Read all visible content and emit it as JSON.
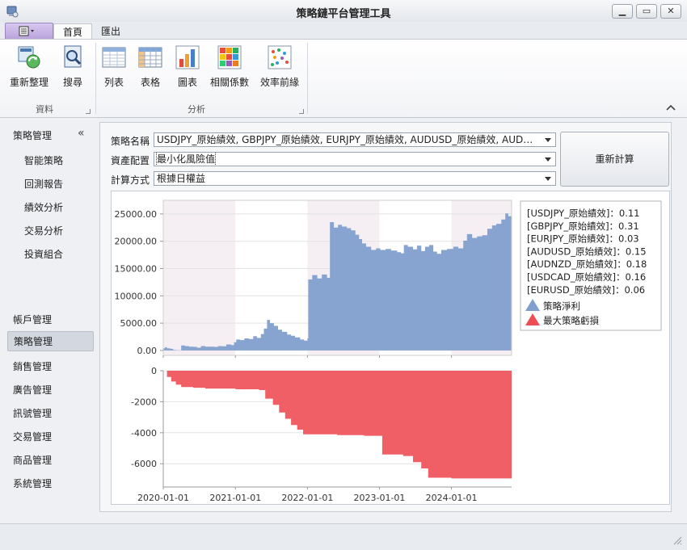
{
  "window": {
    "title": "策略鏈平台管理工具"
  },
  "tabs": [
    {
      "label": "首頁",
      "active": true
    },
    {
      "label": "匯出",
      "active": false
    }
  ],
  "ribbon": {
    "groups": [
      {
        "label": "資料",
        "buttons": [
          {
            "label": "重新整理",
            "icon": "refresh-icon"
          },
          {
            "label": "搜尋",
            "icon": "search-icon"
          }
        ]
      },
      {
        "label": "分析",
        "buttons": [
          {
            "label": "列表",
            "icon": "list-icon"
          },
          {
            "label": "表格",
            "icon": "table-icon"
          },
          {
            "label": "圖表",
            "icon": "bar-chart-icon"
          },
          {
            "label": "相關係數",
            "icon": "correlation-icon"
          },
          {
            "label": "效率前緣",
            "icon": "scatter-icon"
          }
        ]
      }
    ]
  },
  "sidebar": {
    "header": "策略管理",
    "sub_items": [
      "智能策略",
      "回測報告",
      "績效分析",
      "交易分析",
      "投資組合"
    ],
    "items": [
      "帳戶管理",
      "策略管理",
      "銷售管理",
      "廣告管理",
      "訊號管理",
      "交易管理",
      "商品管理",
      "系統管理"
    ],
    "selected": "策略管理"
  },
  "form": {
    "strategy_label": "策略名稱",
    "strategy_value": "USDJPY_原始績效, GBPJPY_原始績效, EURJPY_原始績效, AUDUSD_原始績效, AUDNZD_原始績效",
    "allocation_label": "資產配置",
    "allocation_value": "最小化風險值",
    "method_label": "計算方式",
    "method_value": "根據日權益",
    "recalc_button": "重新計算"
  },
  "legend": {
    "weights": [
      "[USDJPY_原始績效]：0.11",
      "[GBPJPY_原始績效]：0.31",
      "[EURJPY_原始績效]：0.03",
      "[AUDUSD_原始績效]：0.15",
      "[AUDNZD_原始績效]：0.18",
      "[USDCAD_原始績效]：0.16",
      "[EURUSD_原始績效]：0.06"
    ],
    "series": [
      {
        "name": "策略淨利",
        "color": "#7f9fcc"
      },
      {
        "name": "最大策略虧損",
        "color": "#ee4d55"
      }
    ]
  },
  "chart_data": {
    "type": "area",
    "x_ticks": [
      "2020-01-01",
      "2021-01-01",
      "2022-01-01",
      "2023-01-01",
      "2024-01-01"
    ],
    "x_range": [
      "2020-01-01",
      "2024-11-01"
    ],
    "panels": [
      {
        "series": "策略淨利",
        "ylim": [
          -900,
          27500
        ],
        "y_ticks": [
          0,
          5000,
          10000,
          15000,
          20000,
          25000
        ],
        "y_tick_labels": [
          "0.00",
          "5000.00",
          "10000.00",
          "15000.00",
          "20000.00",
          "25000.00"
        ],
        "color": "#7f9fcc",
        "points": [
          [
            "2020-01-01",
            400
          ],
          [
            "2020-01-10",
            600
          ],
          [
            "2020-01-20",
            400
          ],
          [
            "2020-02-05",
            300
          ],
          [
            "2020-02-20",
            100
          ],
          [
            "2020-03-05",
            50
          ],
          [
            "2020-04-01",
            900
          ],
          [
            "2020-04-20",
            800
          ],
          [
            "2020-05-10",
            700
          ],
          [
            "2020-06-01",
            650
          ],
          [
            "2020-06-20",
            500
          ],
          [
            "2020-07-10",
            800
          ],
          [
            "2020-08-01",
            700
          ],
          [
            "2020-08-20",
            700
          ],
          [
            "2020-09-15",
            650
          ],
          [
            "2020-10-05",
            800
          ],
          [
            "2020-10-25",
            750
          ],
          [
            "2020-11-15",
            1100
          ],
          [
            "2020-12-10",
            1000
          ],
          [
            "2020-12-25",
            1500
          ],
          [
            "2021-01-05",
            2000
          ],
          [
            "2021-01-25",
            1900
          ],
          [
            "2021-02-15",
            2200
          ],
          [
            "2021-03-10",
            2100
          ],
          [
            "2021-04-01",
            2600
          ],
          [
            "2021-04-20",
            2300
          ],
          [
            "2021-05-10",
            3000
          ],
          [
            "2021-05-25",
            4000
          ],
          [
            "2021-06-10",
            5600
          ],
          [
            "2021-06-25",
            5000
          ],
          [
            "2021-07-15",
            4500
          ],
          [
            "2021-08-05",
            3800
          ],
          [
            "2021-08-25",
            3400
          ],
          [
            "2021-09-20",
            2900
          ],
          [
            "2021-10-10",
            2700
          ],
          [
            "2021-10-30",
            2400
          ],
          [
            "2021-11-25",
            2000
          ],
          [
            "2021-12-15",
            1800
          ],
          [
            "2022-01-01",
            2200
          ],
          [
            "2022-01-05",
            13000
          ],
          [
            "2022-01-25",
            13800
          ],
          [
            "2022-02-20",
            13200
          ],
          [
            "2022-03-15",
            13900
          ],
          [
            "2022-04-10",
            13300
          ],
          [
            "2022-04-25",
            23500
          ],
          [
            "2022-05-15",
            22500
          ],
          [
            "2022-06-05",
            23000
          ],
          [
            "2022-06-25",
            22700
          ],
          [
            "2022-07-20",
            22400
          ],
          [
            "2022-08-10",
            22000
          ],
          [
            "2022-09-01",
            21200
          ],
          [
            "2022-09-20",
            20400
          ],
          [
            "2022-10-05",
            19600
          ],
          [
            "2022-10-25",
            19000
          ],
          [
            "2022-11-20",
            18400
          ],
          [
            "2022-12-15",
            18700
          ],
          [
            "2023-01-05",
            18400
          ],
          [
            "2023-02-01",
            18600
          ],
          [
            "2023-03-01",
            18300
          ],
          [
            "2023-04-01",
            18000
          ],
          [
            "2023-04-20",
            17800
          ],
          [
            "2023-05-05",
            19300
          ],
          [
            "2023-05-25",
            19000
          ],
          [
            "2023-06-20",
            18500
          ],
          [
            "2023-07-10",
            19200
          ],
          [
            "2023-08-01",
            18200
          ],
          [
            "2023-08-20",
            19000
          ],
          [
            "2023-09-10",
            19300
          ],
          [
            "2023-10-01",
            18100
          ],
          [
            "2023-10-20",
            17700
          ],
          [
            "2023-11-10",
            18400
          ],
          [
            "2023-12-10",
            18600
          ],
          [
            "2024-01-10",
            19000
          ],
          [
            "2024-02-05",
            18700
          ],
          [
            "2024-03-01",
            20100
          ],
          [
            "2024-03-20",
            21300
          ],
          [
            "2024-04-15",
            20600
          ],
          [
            "2024-05-10",
            20900
          ],
          [
            "2024-06-05",
            21100
          ],
          [
            "2024-07-01",
            22300
          ],
          [
            "2024-07-25",
            22900
          ],
          [
            "2024-08-15",
            23200
          ],
          [
            "2024-09-10",
            24000
          ],
          [
            "2024-09-30",
            25100
          ],
          [
            "2024-10-15",
            24600
          ],
          [
            "2024-11-01",
            24900
          ]
        ]
      },
      {
        "series": "最大策略虧損",
        "ylim": [
          -7500,
          0
        ],
        "y_ticks": [
          0,
          -2000,
          -4000,
          -6000
        ],
        "y_tick_labels": [
          "0",
          "-2000",
          "-4000",
          "-6000"
        ],
        "color": "#ee4d55",
        "points": [
          [
            "2020-01-01",
            0
          ],
          [
            "2020-01-20",
            -400
          ],
          [
            "2020-02-10",
            -700
          ],
          [
            "2020-03-05",
            -900
          ],
          [
            "2020-04-01",
            -1050
          ],
          [
            "2020-06-01",
            -1100
          ],
          [
            "2020-08-01",
            -1150
          ],
          [
            "2021-01-01",
            -1200
          ],
          [
            "2021-05-01",
            -1250
          ],
          [
            "2021-06-01",
            -1800
          ],
          [
            "2021-07-10",
            -2200
          ],
          [
            "2021-08-10",
            -2700
          ],
          [
            "2021-09-10",
            -3100
          ],
          [
            "2021-10-10",
            -3500
          ],
          [
            "2021-11-10",
            -3800
          ],
          [
            "2021-12-10",
            -4100
          ],
          [
            "2022-06-01",
            -4150
          ],
          [
            "2022-10-15",
            -4200
          ],
          [
            "2023-01-01",
            -4200
          ],
          [
            "2023-01-15",
            -5400
          ],
          [
            "2023-05-01",
            -5500
          ],
          [
            "2023-06-20",
            -5900
          ],
          [
            "2023-08-01",
            -6300
          ],
          [
            "2023-09-05",
            -6900
          ],
          [
            "2024-01-01",
            -6950
          ],
          [
            "2024-11-01",
            -6950
          ]
        ]
      }
    ]
  }
}
